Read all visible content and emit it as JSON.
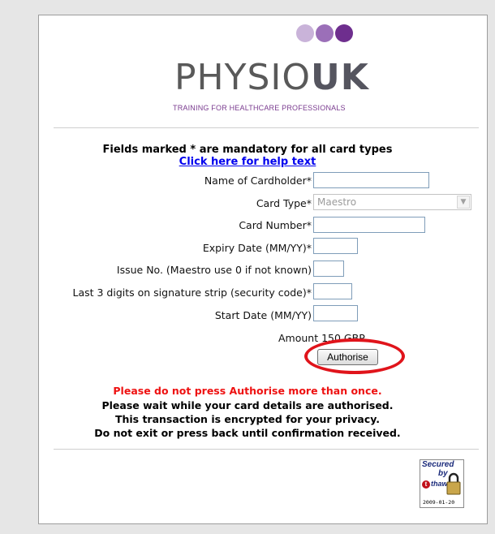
{
  "brand": {
    "logo_prefix": "PHYSIO",
    "logo_suffix": "UK",
    "tagline": "TRAINING FOR HEALTHCARE PROFESSIONALS",
    "dot_colors": [
      "#c9b3d9",
      "#9b6fb8",
      "#6e2e8e"
    ]
  },
  "form": {
    "mandatory_note": "Fields marked * are mandatory for all card types",
    "help_link": "Click here for help text",
    "fields": {
      "cardholder": {
        "label": "Name of Cardholder*",
        "value": ""
      },
      "card_type": {
        "label": "Card Type*",
        "selected": "Maestro"
      },
      "card_number": {
        "label": "Card Number*",
        "value": ""
      },
      "expiry": {
        "label": "Expiry Date (MM/YY)*",
        "value": ""
      },
      "issue_no": {
        "label": "Issue No. (Maestro use 0 if not known)",
        "value": ""
      },
      "security_code": {
        "label": "Last 3 digits on signature strip (security code)*",
        "value": ""
      },
      "start_date": {
        "label": "Start Date (MM/YY)",
        "value": ""
      }
    },
    "amount": "Amount 150 GBP",
    "submit_label": "Authorise"
  },
  "notices": {
    "warning": "Please do not press Authorise more than once.",
    "line1": "Please wait while your card details are authorised.",
    "line2": "This transaction is encrypted for your privacy.",
    "line3": "Do not exit or press back until confirmation received."
  },
  "seal": {
    "secured": "Secured",
    "by": "by",
    "brand": "thawte",
    "date": "2009-01-20"
  },
  "colors": {
    "warning": "#ee1111",
    "link": "#0000ee",
    "highlight": "#e0141b",
    "tagline": "#7a3b8f"
  }
}
